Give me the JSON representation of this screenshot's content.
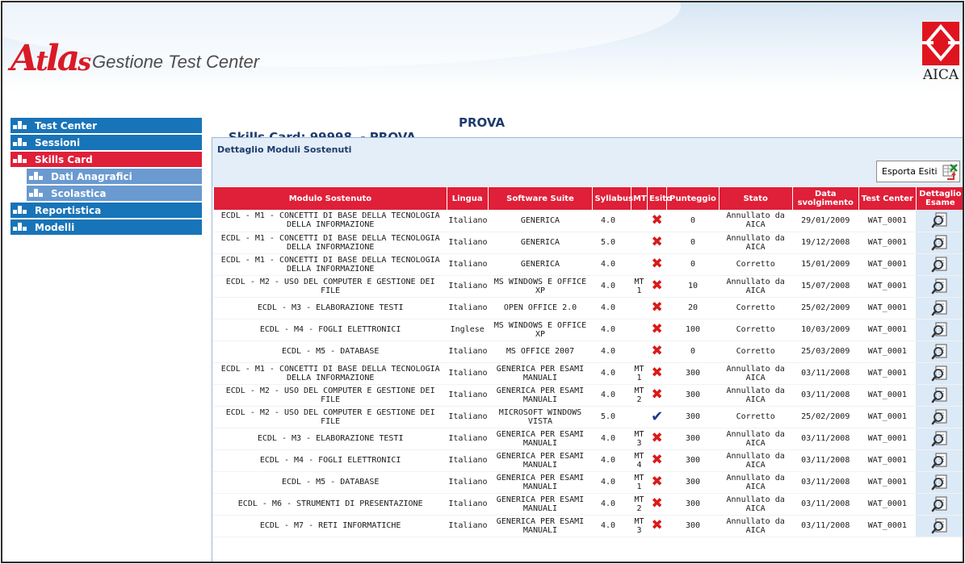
{
  "app": {
    "logo_text": "Atlas",
    "subtitle": "Gestione Test Center",
    "partner_logo_text": "AICA"
  },
  "colors": {
    "nav_blue": "#1874b8",
    "nav_active_red": "#e01f38",
    "nav_sub_blue": "#6a9ad0",
    "table_header_red": "#e01f38",
    "title_navy": "#1f3b6e"
  },
  "sidebar": {
    "items": [
      {
        "label": "Test Center",
        "state": "default"
      },
      {
        "label": "Sessioni",
        "state": "default"
      },
      {
        "label": "Skills Card",
        "state": "active"
      },
      {
        "label": "Dati Anagrafici",
        "state": "sub"
      },
      {
        "label": "Scolastica",
        "state": "sub"
      },
      {
        "label": "Reportistica",
        "state": "default"
      },
      {
        "label": "Modelli",
        "state": "default"
      }
    ]
  },
  "page": {
    "title": "Skills Card: 99998  - PROVA",
    "title_surname": "PROVA",
    "panel_title": "Dettaglio Moduli Sostenuti",
    "export_label": "Esporta Esiti"
  },
  "table": {
    "headers": [
      "Modulo Sostenuto",
      "Lingua",
      "Software Suite",
      "Syllabus",
      "MT",
      "Esito",
      "Punteggio",
      "Stato",
      "Data svolgimento",
      "Test Center",
      "Dettaglio Esame"
    ],
    "rows": [
      {
        "modulo": "ECDL - M1 - CONCETTI DI BASE DELLA TECNOLOGIA DELLA INFORMAZIONE",
        "lingua": "Italiano",
        "suite": "GENERICA",
        "syllabus": "4.0",
        "mt": "",
        "esito": "fail",
        "punteggio": "0",
        "stato": "Annullato da AICA",
        "data": "29/01/2009",
        "center": "WAT_0001"
      },
      {
        "modulo": "ECDL - M1 - CONCETTI DI BASE DELLA TECNOLOGIA DELLA INFORMAZIONE",
        "lingua": "Italiano",
        "suite": "GENERICA",
        "syllabus": "5.0",
        "mt": "",
        "esito": "fail",
        "punteggio": "0",
        "stato": "Annullato da AICA",
        "data": "19/12/2008",
        "center": "WAT_0001"
      },
      {
        "modulo": "ECDL - M1 - CONCETTI DI BASE DELLA TECNOLOGIA DELLA INFORMAZIONE",
        "lingua": "Italiano",
        "suite": "GENERICA",
        "syllabus": "4.0",
        "mt": "",
        "esito": "fail",
        "punteggio": "0",
        "stato": "Corretto",
        "data": "15/01/2009",
        "center": "WAT_0001"
      },
      {
        "modulo": "ECDL - M2 - USO DEL COMPUTER E GESTIONE DEI FILE",
        "lingua": "Italiano",
        "suite": "MS WINDOWS E OFFICE XP",
        "syllabus": "4.0",
        "mt": "MT 1",
        "esito": "fail",
        "punteggio": "10",
        "stato": "Annullato da AICA",
        "data": "15/07/2008",
        "center": "WAT_0001"
      },
      {
        "modulo": "ECDL - M3 - ELABORAZIONE TESTI",
        "lingua": "Italiano",
        "suite": "OPEN OFFICE 2.0",
        "syllabus": "4.0",
        "mt": "",
        "esito": "fail",
        "punteggio": "20",
        "stato": "Corretto",
        "data": "25/02/2009",
        "center": "WAT_0001"
      },
      {
        "modulo": "ECDL - M4 - FOGLI ELETTRONICI",
        "lingua": "Inglese",
        "suite": "MS WINDOWS E OFFICE XP",
        "syllabus": "4.0",
        "mt": "",
        "esito": "fail",
        "punteggio": "100",
        "stato": "Corretto",
        "data": "10/03/2009",
        "center": "WAT_0001"
      },
      {
        "modulo": "ECDL - M5 - DATABASE",
        "lingua": "Italiano",
        "suite": "MS OFFICE 2007",
        "syllabus": "4.0",
        "mt": "",
        "esito": "fail",
        "punteggio": "0",
        "stato": "Corretto",
        "data": "25/03/2009",
        "center": "WAT_0001"
      },
      {
        "modulo": "ECDL - M1 - CONCETTI DI BASE DELLA TECNOLOGIA DELLA INFORMAZIONE",
        "lingua": "Italiano",
        "suite": "GENERICA PER ESAMI MANUALI",
        "syllabus": "4.0",
        "mt": "MT 1",
        "esito": "fail",
        "punteggio": "300",
        "stato": "Annullato da AICA",
        "data": "03/11/2008",
        "center": "WAT_0001"
      },
      {
        "modulo": "ECDL - M2 - USO DEL COMPUTER E GESTIONE DEI FILE",
        "lingua": "Italiano",
        "suite": "GENERICA PER ESAMI MANUALI",
        "syllabus": "4.0",
        "mt": "MT 2",
        "esito": "fail",
        "punteggio": "300",
        "stato": "Annullato da AICA",
        "data": "03/11/2008",
        "center": "WAT_0001"
      },
      {
        "modulo": "ECDL - M2 - USO DEL COMPUTER E GESTIONE DEI FILE",
        "lingua": "Italiano",
        "suite": "MICROSOFT WINDOWS VISTA",
        "syllabus": "5.0",
        "mt": "",
        "esito": "pass",
        "punteggio": "300",
        "stato": "Corretto",
        "data": "25/02/2009",
        "center": "WAT_0001"
      },
      {
        "modulo": "ECDL - M3 - ELABORAZIONE TESTI",
        "lingua": "Italiano",
        "suite": "GENERICA PER ESAMI MANUALI",
        "syllabus": "4.0",
        "mt": "MT 3",
        "esito": "fail",
        "punteggio": "300",
        "stato": "Annullato da AICA",
        "data": "03/11/2008",
        "center": "WAT_0001"
      },
      {
        "modulo": "ECDL - M4 - FOGLI ELETTRONICI",
        "lingua": "Italiano",
        "suite": "GENERICA PER ESAMI MANUALI",
        "syllabus": "4.0",
        "mt": "MT 4",
        "esito": "fail",
        "punteggio": "300",
        "stato": "Annullato da AICA",
        "data": "03/11/2008",
        "center": "WAT_0001"
      },
      {
        "modulo": "ECDL - M5 - DATABASE",
        "lingua": "Italiano",
        "suite": "GENERICA PER ESAMI MANUALI",
        "syllabus": "4.0",
        "mt": "MT 1",
        "esito": "fail",
        "punteggio": "300",
        "stato": "Annullato da AICA",
        "data": "03/11/2008",
        "center": "WAT_0001"
      },
      {
        "modulo": "ECDL - M6 - STRUMENTI DI PRESENTAZIONE",
        "lingua": "Italiano",
        "suite": "GENERICA PER ESAMI MANUALI",
        "syllabus": "4.0",
        "mt": "MT 2",
        "esito": "fail",
        "punteggio": "300",
        "stato": "Annullato da AICA",
        "data": "03/11/2008",
        "center": "WAT_0001"
      },
      {
        "modulo": "ECDL - M7 - RETI INFORMATICHE",
        "lingua": "Italiano",
        "suite": "GENERICA PER ESAMI MANUALI",
        "syllabus": "4.0",
        "mt": "MT 3",
        "esito": "fail",
        "punteggio": "300",
        "stato": "Annullato da AICA",
        "data": "03/11/2008",
        "center": "WAT_0001"
      }
    ]
  },
  "icons": {
    "fail": "close-x-icon",
    "pass": "checkmark-icon",
    "detail": "magnifier-document-icon",
    "export": "excel-export-icon"
  }
}
